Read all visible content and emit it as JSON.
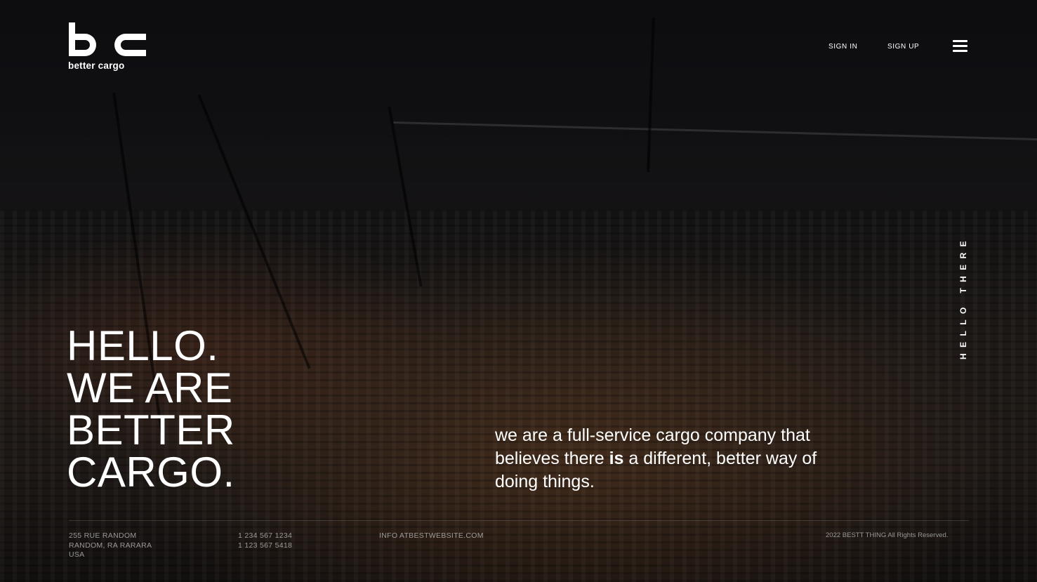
{
  "brand": {
    "mark": "bc",
    "name": "better cargo"
  },
  "nav": {
    "sign_in": "SIGN IN",
    "sign_up": "SIGN UP"
  },
  "side_label": "HELLO THERE",
  "hero": {
    "lines": [
      "HELLO.",
      "WE ARE",
      "BETTER",
      "CARGO."
    ],
    "tagline_part1": "we are a full-service cargo company that believes there ",
    "tagline_bold": "is",
    "tagline_part2": " a different, better way of doing things."
  },
  "footer": {
    "address": [
      "255 RUE RANDOM",
      "RANDOM, RA RARARA",
      "USA"
    ],
    "phones": [
      "1 234 567 1234",
      "1 123 567 5418"
    ],
    "email": "INFO ATBESTWEBSITE.COM",
    "copyright": "2022 BESTT THING All Rights Reserved."
  },
  "icons": {
    "menu": "hamburger-menu-icon"
  },
  "colors": {
    "text": "#ffffff",
    "muted": "#8c8c8c",
    "background": "#0c0c10"
  }
}
